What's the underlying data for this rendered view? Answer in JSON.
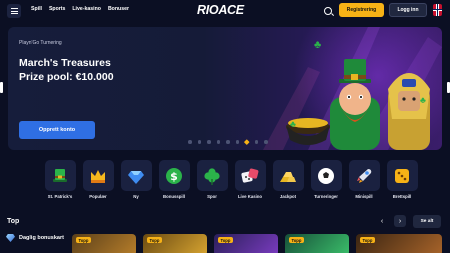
{
  "header": {
    "nav": [
      "Spill",
      "Sports",
      "Live-kasino",
      "Bonuser"
    ],
    "logo": "RIOACE",
    "register_label": "Registrering",
    "login_label": "Logg inn"
  },
  "banner": {
    "subtitle": "Playn'Go Turnering",
    "title": "March's Treasures",
    "prize": "Prize pool: €10.000",
    "cta_label": "Opprett konto",
    "slide_count": 9,
    "active_slide": 7
  },
  "categories": [
    {
      "label": "St. Patrick's",
      "icon": "leprechaun-hat-icon"
    },
    {
      "label": "Populær",
      "icon": "crown-icon"
    },
    {
      "label": "Ny",
      "icon": "diamond-icon"
    },
    {
      "label": "Bonusspill",
      "icon": "dollar-coin-icon"
    },
    {
      "label": "Spor",
      "icon": "clover-icon"
    },
    {
      "label": "Live Kasino",
      "icon": "dice-icon"
    },
    {
      "label": "Jackpot",
      "icon": "gold-bars-icon"
    },
    {
      "label": "Turneringer",
      "icon": "soccer-ball-icon"
    },
    {
      "label": "Minispill",
      "icon": "rocket-icon"
    },
    {
      "label": "Brettspill",
      "icon": "board-dice-icon"
    }
  ],
  "top_section": {
    "title": "Top",
    "see_all_label": "Se alt",
    "bonus_label": "Daglig bonuskart",
    "game_badge": "Topp"
  },
  "colors": {
    "accent": "#f7b216",
    "primary_button": "#2f6fe4",
    "background": "#0b0f23"
  }
}
